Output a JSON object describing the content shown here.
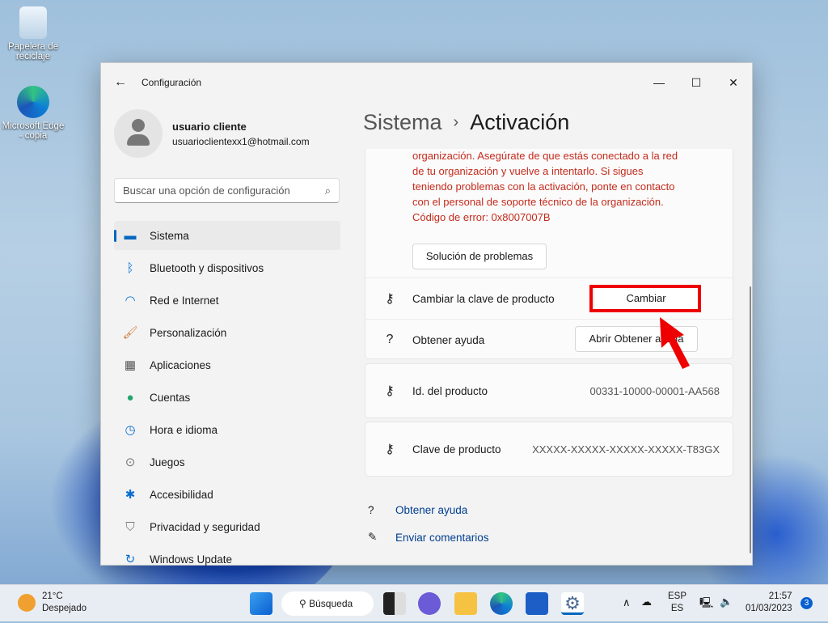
{
  "desktop": {
    "icons": [
      {
        "label": "Papelera de reciclaje"
      },
      {
        "label": "Microsoft Edge - copia"
      }
    ]
  },
  "window": {
    "title": "Configuración",
    "controls": {
      "minimize": "—",
      "maximize": "☐",
      "close": "✕"
    }
  },
  "user": {
    "name": "usuario cliente",
    "email": "usuarioclientexx1@hotmail.com"
  },
  "search": {
    "placeholder": "Buscar una opción de configuración"
  },
  "nav": [
    {
      "label": "Sistema",
      "icon": "monitor-icon"
    },
    {
      "label": "Bluetooth y dispositivos",
      "icon": "bluetooth-icon"
    },
    {
      "label": "Red e Internet",
      "icon": "wifi-icon"
    },
    {
      "label": "Personalización",
      "icon": "brush-icon"
    },
    {
      "label": "Aplicaciones",
      "icon": "apps-icon"
    },
    {
      "label": "Cuentas",
      "icon": "person-icon"
    },
    {
      "label": "Hora e idioma",
      "icon": "clock-icon"
    },
    {
      "label": "Juegos",
      "icon": "gamepad-icon"
    },
    {
      "label": "Accesibilidad",
      "icon": "accessibility-icon"
    },
    {
      "label": "Privacidad y seguridad",
      "icon": "shield-icon"
    },
    {
      "label": "Windows Update",
      "icon": "update-icon"
    }
  ],
  "breadcrumb": {
    "parent": "Sistema",
    "current": "Activación"
  },
  "activation": {
    "error_lines": [
      "organización. Asegúrate de que estás conectado a la red",
      "de tu organización y vuelve a intentarlo. Si sigues",
      "teniendo problemas con la activación, ponte en contacto",
      "con el personal de soporte técnico de la organización.",
      "Código de error: 0x8007007B"
    ],
    "troubleshoot": "Solución de problemas",
    "change_key_label": "Cambiar la clave de producto",
    "change_button": "Cambiar",
    "get_help_label": "Obtener ayuda",
    "get_help_button": "Abrir Obtener ayuda",
    "product_id_label": "Id. del producto",
    "product_id": "00331-10000-00001-AA568",
    "product_key_label": "Clave de producto",
    "product_key": "XXXXX-XXXXX-XXXXX-XXXXX-T83GX"
  },
  "links": {
    "help": "Obtener ayuda",
    "feedback": "Enviar comentarios"
  },
  "taskbar": {
    "weather_temp": "21°C",
    "weather_desc": "Despejado",
    "search": "Búsqueda",
    "lang1": "ESP",
    "lang2": "ES",
    "time": "21:57",
    "date": "01/03/2023",
    "notif": "3"
  }
}
